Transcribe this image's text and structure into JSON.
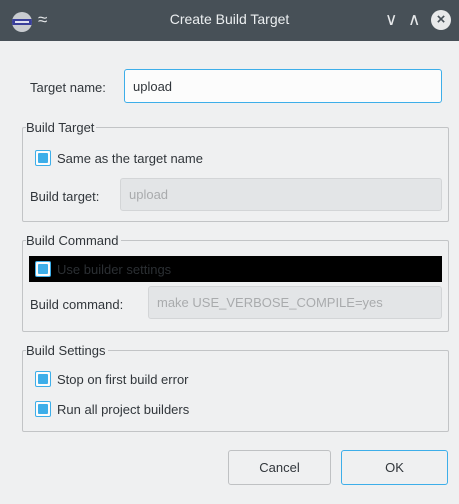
{
  "window": {
    "title": "Create Build Target",
    "controls": {
      "collapse_glyph": "≈",
      "minimize_glyph": "∨",
      "maximize_glyph": "∧",
      "close_glyph": "×"
    },
    "icons": [
      "app-icon",
      "keep-above-icon",
      "minimize-icon",
      "maximize-icon",
      "close-icon"
    ]
  },
  "target_name": {
    "label": "Target name:",
    "value": "upload"
  },
  "build_target_group": {
    "title": "Build Target",
    "same_as_target_name": {
      "label": "Same as the target name",
      "checked": true
    },
    "build_target": {
      "label": "Build target:",
      "value": "upload"
    }
  },
  "build_command_group": {
    "title": "Build Command",
    "use_builder_settings": {
      "label": "Use builder settings",
      "checked": true
    },
    "build_command": {
      "label": "Build command:",
      "value": "make USE_VERBOSE_COMPILE=yes"
    }
  },
  "build_settings_group": {
    "title": "Build Settings",
    "stop_on_first_error": {
      "label": "Stop on first build error",
      "checked": true
    },
    "run_all_builders": {
      "label": "Run all project builders",
      "checked": true
    }
  },
  "buttons": {
    "cancel": "Cancel",
    "ok": "OK"
  },
  "colors": {
    "titlebar": "#475057",
    "window_bg": "#eff0f1",
    "accent": "#3daee9",
    "text": "#31363b"
  }
}
